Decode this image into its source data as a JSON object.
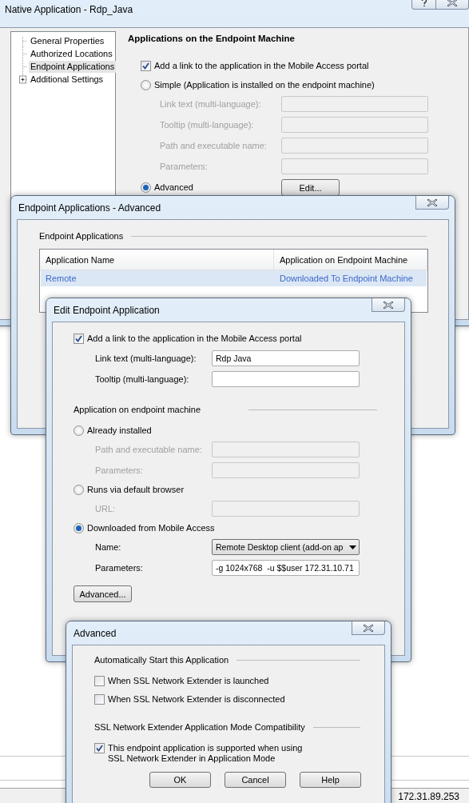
{
  "main_window": {
    "title": "Native Application - Rdp_Java",
    "tree": [
      {
        "label": "General Properties",
        "selected": false,
        "expandable": false
      },
      {
        "label": "Authorized Locations",
        "selected": false,
        "expandable": false
      },
      {
        "label": "Endpoint Applications",
        "selected": true,
        "expandable": false
      },
      {
        "label": "Additional Settings",
        "selected": false,
        "expandable": true
      }
    ],
    "heading": "Applications on the Endpoint Machine",
    "portal_link": {
      "label": "Add a link to the application in the Mobile Access portal",
      "checked": true
    },
    "options": [
      {
        "label": "Simple (Application is installed on the endpoint machine)",
        "selected": false,
        "fields": [
          {
            "label": "Link text (multi-language):",
            "kind": "text",
            "disabled": true
          },
          {
            "label": "Tooltip (multi-language):",
            "kind": "text",
            "disabled": true
          },
          {
            "label": "Path and executable name:",
            "kind": "text",
            "disabled": true
          },
          {
            "label": "Parameters:",
            "kind": "text",
            "disabled": true
          }
        ]
      },
      {
        "label": "Advanced",
        "selected": true,
        "button": "Edit..."
      }
    ]
  },
  "advanced_list_window": {
    "title": "Endpoint Applications - Advanced",
    "group_label": "Endpoint Applications",
    "columns": [
      "Application Name",
      "Application on Endpoint Machine"
    ],
    "rows": [
      {
        "cells": [
          "Remote",
          "Downloaded To Endpoint Machine"
        ],
        "selected": true
      }
    ]
  },
  "edit_window": {
    "title": "Edit Endpoint Application",
    "portal_link": {
      "label": "Add a link to the application in the Mobile Access portal",
      "checked": true
    },
    "link_fields": [
      {
        "label": "Link text (multi-language):",
        "kind": "text",
        "value": "Rdp Java",
        "disabled": false
      },
      {
        "label": "Tooltip (multi-language):",
        "kind": "text",
        "disabled": false
      }
    ],
    "group_label": "Application on endpoint machine",
    "options": [
      {
        "label": "Already installed",
        "selected": false,
        "fields": [
          {
            "label": "Path and executable name:",
            "kind": "text",
            "disabled": true
          },
          {
            "label": "Parameters:",
            "kind": "text",
            "disabled": true
          }
        ]
      },
      {
        "label": "Runs via default browser",
        "selected": false,
        "fields": [
          {
            "label": "URL:",
            "kind": "text",
            "disabled": true
          }
        ]
      },
      {
        "label": "Downloaded from Mobile Access",
        "selected": true,
        "fields": [
          {
            "label": "Name:",
            "kind": "dropdown",
            "value": "Remote Desktop client (add-on ap",
            "disabled": false
          },
          {
            "label": "Parameters:",
            "kind": "text",
            "value": "-g 1024x768  -u $$user 172.31.10.71",
            "disabled": false
          }
        ]
      }
    ],
    "advanced_button": "Advanced..."
  },
  "advanced_window": {
    "title": "Advanced",
    "groups": [
      {
        "label": "Automatically Start this Application",
        "options": [
          {
            "label": "When SSL Network Extender is launched",
            "checked": false
          },
          {
            "label": "When SSL Network Extender is disconnected",
            "checked": false
          }
        ]
      },
      {
        "label": "SSL Network Extender Application Mode Compatibility",
        "options": [
          {
            "label": "This endpoint application is supported when using\nSSL Network Extender in Application Mode",
            "checked": true
          }
        ]
      }
    ],
    "buttons": [
      "OK",
      "Cancel",
      "Help"
    ]
  },
  "status_bar": {
    "address": "172.31.89.253"
  }
}
